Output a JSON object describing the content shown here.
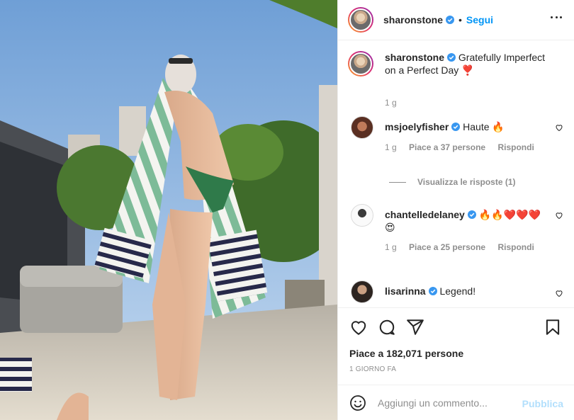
{
  "header": {
    "username": "sharonstone",
    "separator": "•",
    "follow_label": "Segui"
  },
  "caption": {
    "username": "sharonstone",
    "text": "Gratefully Imperfect on a Perfect Day",
    "emoji": "❣️",
    "time": "1 g"
  },
  "comments": [
    {
      "username": "msjoelyfisher",
      "text": "Haute 🔥",
      "time": "1 g",
      "likes": "Piace a 37 persone",
      "reply_label": "Rispondi",
      "view_replies": "Visualizza le risposte (1)"
    },
    {
      "username": "chantelledelaney",
      "text": "🔥🔥❤️❤️❤️😍",
      "time": "1 g",
      "likes": "Piace a 25 persone",
      "reply_label": "Rispondi"
    },
    {
      "username": "lisarinna",
      "text": "Legend!"
    }
  ],
  "actions": {
    "likes": "Piace a 182,071 persone",
    "ago": "1 GIORNO FA"
  },
  "add_comment": {
    "placeholder": "Aggiungi un commento...",
    "publish_label": "Pubblica"
  },
  "icons": {
    "verified": "verified-badge-icon",
    "more": "more-options-icon",
    "heart": "heart-icon",
    "comment": "comment-icon",
    "share": "share-icon",
    "save": "bookmark-icon",
    "emoji": "emoji-icon"
  },
  "colors": {
    "accent": "#0095f6",
    "publish_disabled": "#b2dffc",
    "secondary_text": "#8e8e8e"
  }
}
